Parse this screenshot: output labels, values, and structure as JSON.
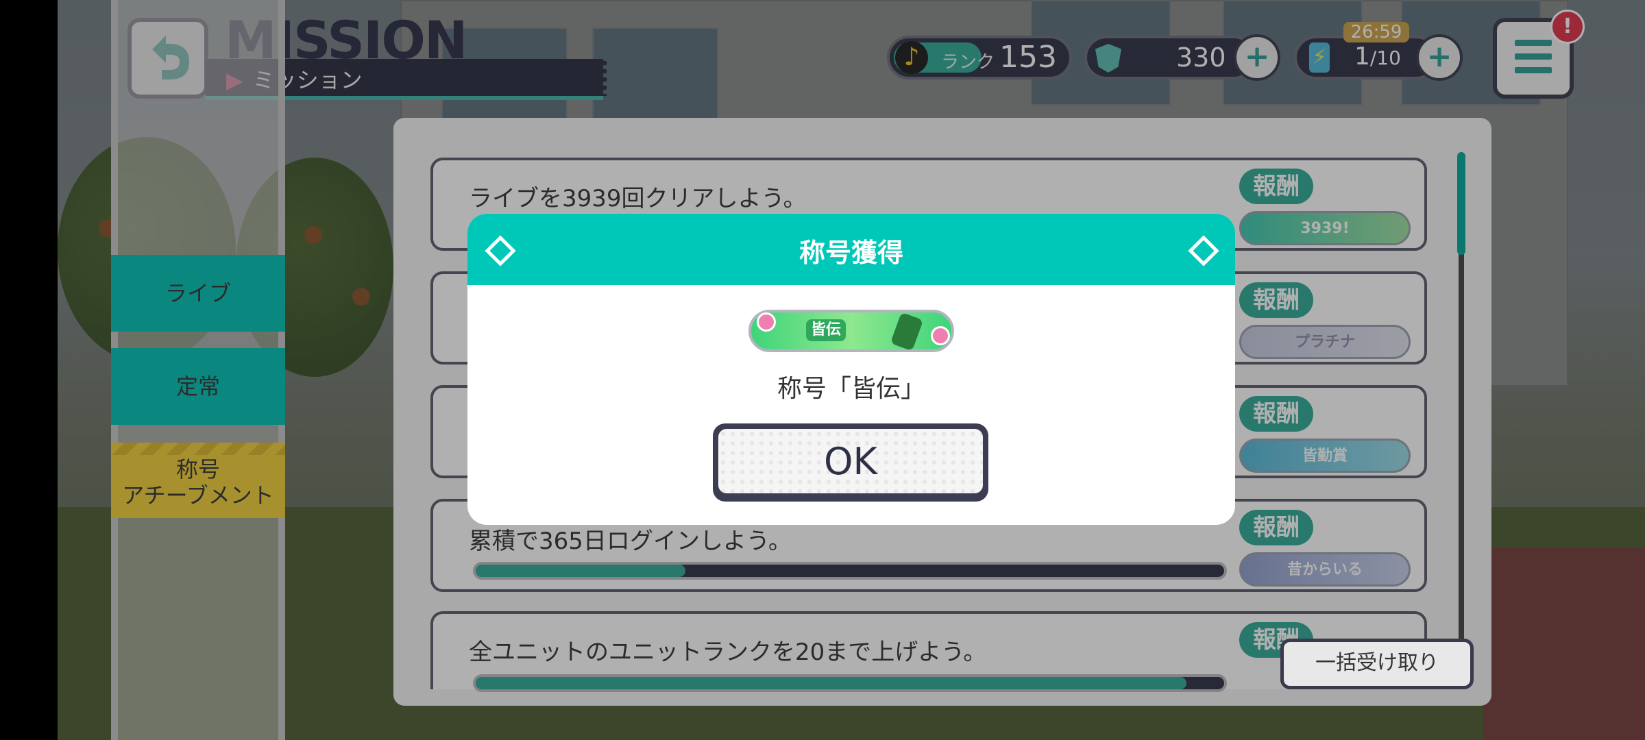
{
  "header": {
    "title": "MISSION",
    "subtitle": "ミッション",
    "rank_label": "ランク",
    "rank_value": "153",
    "gems": "330",
    "energy_current": "1",
    "energy_max": "/10",
    "timer": "26:59",
    "alert": "!"
  },
  "nav": {
    "items": [
      {
        "label": "ライブ"
      },
      {
        "label": "定常"
      },
      {
        "label_line1": "称号",
        "label_line2": "アチーブメント"
      }
    ]
  },
  "missions": {
    "reward_label": "報酬",
    "items": [
      {
        "text": "ライブを3939回クリアしよう。",
        "reward": "3939!"
      },
      {
        "text": "",
        "reward": "プラチナ"
      },
      {
        "text": "",
        "reward": "皆勤賞"
      },
      {
        "text": "累積で365日ログインしよう。",
        "reward": "昔からいる",
        "progress": 0.28
      },
      {
        "text": "全ユニットのユニットランクを20まで上げよう。",
        "reward": "",
        "progress": 0.95
      }
    ],
    "collect_all": "一括受け取り"
  },
  "modal": {
    "title": "称号獲得",
    "badge_text": "皆伝",
    "message": "称号「皆伝」",
    "ok": "OK"
  },
  "colors": {
    "accent": "#00c8b8",
    "dark": "#2e3046",
    "yellow": "#f2d03a"
  }
}
